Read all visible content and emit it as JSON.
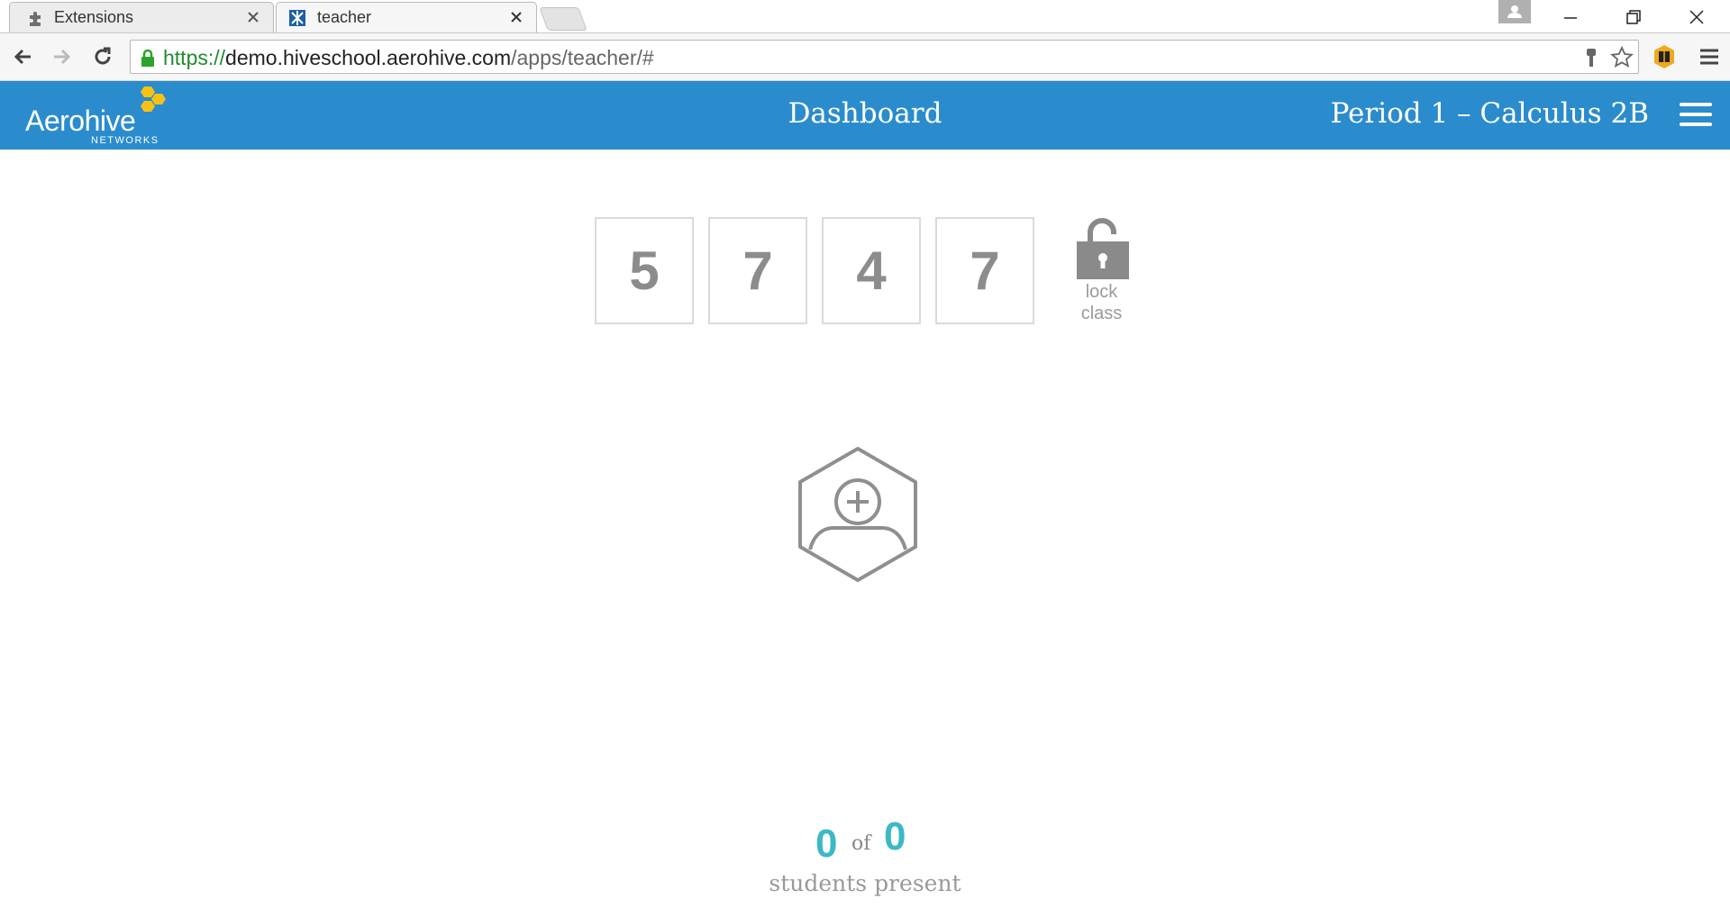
{
  "browser": {
    "tabs": [
      {
        "label": "Extensions",
        "active": false
      },
      {
        "label": "teacher",
        "active": true
      }
    ],
    "url": {
      "scheme": "https://",
      "host": "demo.hiveschool.aerohive.com",
      "path": "/apps/teacher/#"
    }
  },
  "header": {
    "logo_text": "Aerohive",
    "logo_sub": "NETWORKS",
    "title": "Dashboard",
    "class_name": "Period 1 – Calculus 2B",
    "brand_color": "#2b8ccd"
  },
  "class_code": {
    "digits": [
      "5",
      "7",
      "4",
      "7"
    ],
    "lock_label_line1": "lock",
    "lock_label_line2": "class"
  },
  "attendance": {
    "present": "0",
    "of_label": "of",
    "total": "0",
    "label": "students present",
    "accent_color": "#3bb9c5"
  },
  "icons": {
    "add_student": "add-student-icon",
    "lock": "unlocked-padlock-icon",
    "menu": "hamburger-menu-icon"
  }
}
